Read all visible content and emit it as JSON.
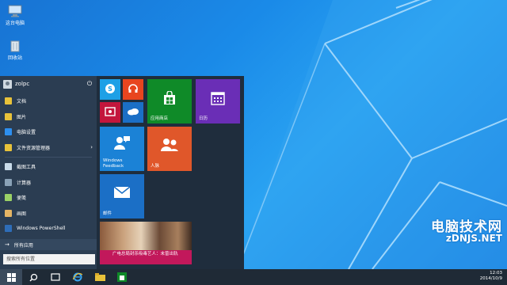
{
  "desktop": {
    "icons": [
      {
        "label": "这台电脑",
        "icon": "computer-icon"
      },
      {
        "label": "回收站",
        "icon": "recycle-bin-icon"
      }
    ]
  },
  "watermark": {
    "cn": "电脑技术网",
    "url": "zDNJS.NET"
  },
  "start_menu": {
    "user": {
      "name": "zolpc",
      "avatar_icon": "user-avatar-icon",
      "power_icon": "power-icon"
    },
    "items": [
      {
        "label": "文档",
        "icon": "documents-icon",
        "color": "#e8c23a"
      },
      {
        "label": "图片",
        "icon": "pictures-icon",
        "color": "#e8c23a"
      },
      {
        "label": "电脑设置",
        "icon": "settings-icon",
        "color": "#2d8ff0"
      },
      {
        "label": "文件资源管理器",
        "icon": "file-explorer-icon",
        "color": "#e8c23a",
        "has_submenu": true
      },
      {
        "label": "截图工具",
        "icon": "snipping-tool-icon",
        "color": "#c9dbe9"
      },
      {
        "label": "计算器",
        "icon": "calculator-icon",
        "color": "#8aa1b6"
      },
      {
        "label": "便笺",
        "icon": "sticky-notes-icon",
        "color": "#9bd166"
      },
      {
        "label": "画图",
        "icon": "paint-icon",
        "color": "#e5b565"
      },
      {
        "label": "Windows PowerShell",
        "icon": "powershell-icon",
        "color": "#2e6db8"
      }
    ],
    "all_apps": {
      "label": "所有应用",
      "icon": "arrow-right-icon"
    },
    "search": {
      "placeholder": "搜索所有位置"
    }
  },
  "tiles": [
    {
      "key": "skype",
      "label": "",
      "icon": "skype-icon",
      "color": "#1ea0e6"
    },
    {
      "key": "music",
      "label": "",
      "icon": "headphones-icon",
      "color": "#e8451f"
    },
    {
      "key": "video",
      "label": "",
      "icon": "video-icon",
      "color": "#c3163c"
    },
    {
      "key": "onedrive",
      "label": "",
      "icon": "onedrive-icon",
      "color": "#1b6fc6"
    },
    {
      "key": "store",
      "label": "应用商店",
      "icon": "store-icon",
      "color": "#0f8a28"
    },
    {
      "key": "calendar",
      "label": "日历",
      "icon": "calendar-icon",
      "color": "#6a2eb6"
    },
    {
      "key": "feedback",
      "label": "Windows Feedback",
      "icon": "feedback-icon",
      "color": "#1b82d6"
    },
    {
      "key": "people",
      "label": "人脉",
      "icon": "people-icon",
      "color": "#e0572a"
    },
    {
      "key": "mail",
      "label": "邮件",
      "icon": "mail-icon",
      "color": "#1b6fc6"
    },
    {
      "key": "news",
      "label": "广电总局封杀吸毒艺人：未曾出轨",
      "icon": "news-icon",
      "color": "#c2185b"
    }
  ],
  "taskbar": {
    "buttons": [
      {
        "icon": "windows-start-icon",
        "active": true
      },
      {
        "icon": "search-icon",
        "active": false
      },
      {
        "icon": "task-view-icon",
        "active": false
      },
      {
        "icon": "internet-explorer-icon",
        "active": false
      },
      {
        "icon": "file-explorer-icon",
        "active": false
      },
      {
        "icon": "store-icon",
        "active": false
      }
    ],
    "clock": {
      "time": "12:03",
      "date": "2014/10/9"
    }
  }
}
